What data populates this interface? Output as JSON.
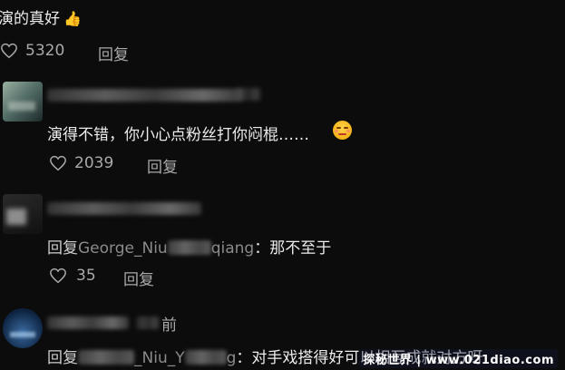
{
  "comments": [
    {
      "text": "演的真好",
      "emoji": "👍",
      "likes": "5320",
      "reply_label": "回复"
    },
    {
      "text": "演得不错，你小心点粉丝打你闷棍……",
      "emoji": "😒",
      "likes": "2039",
      "reply_label": "回复"
    },
    {
      "reply_prefix": "回复",
      "reply_target_start": "George_Niu",
      "reply_target_end": "qiang",
      "colon": "：",
      "text": "那不至于",
      "likes": "35",
      "reply_label": "回复"
    },
    {
      "time_suffix": "前",
      "reply_prefix": "回复",
      "reply_target_mid": "_Niu_Y",
      "reply_target_end": "g",
      "colon": "：",
      "text": "对手戏搭得好可以相互成就对方呀"
    }
  ],
  "watermark": "探秘世界 | www.021diao.com",
  "colors": {
    "background": "#0c0c0c",
    "text": "#ececec",
    "muted": "#a9a9a9"
  },
  "icons": [
    "thumbs-up-icon",
    "heart-outline-icon",
    "unamused-face-icon"
  ]
}
